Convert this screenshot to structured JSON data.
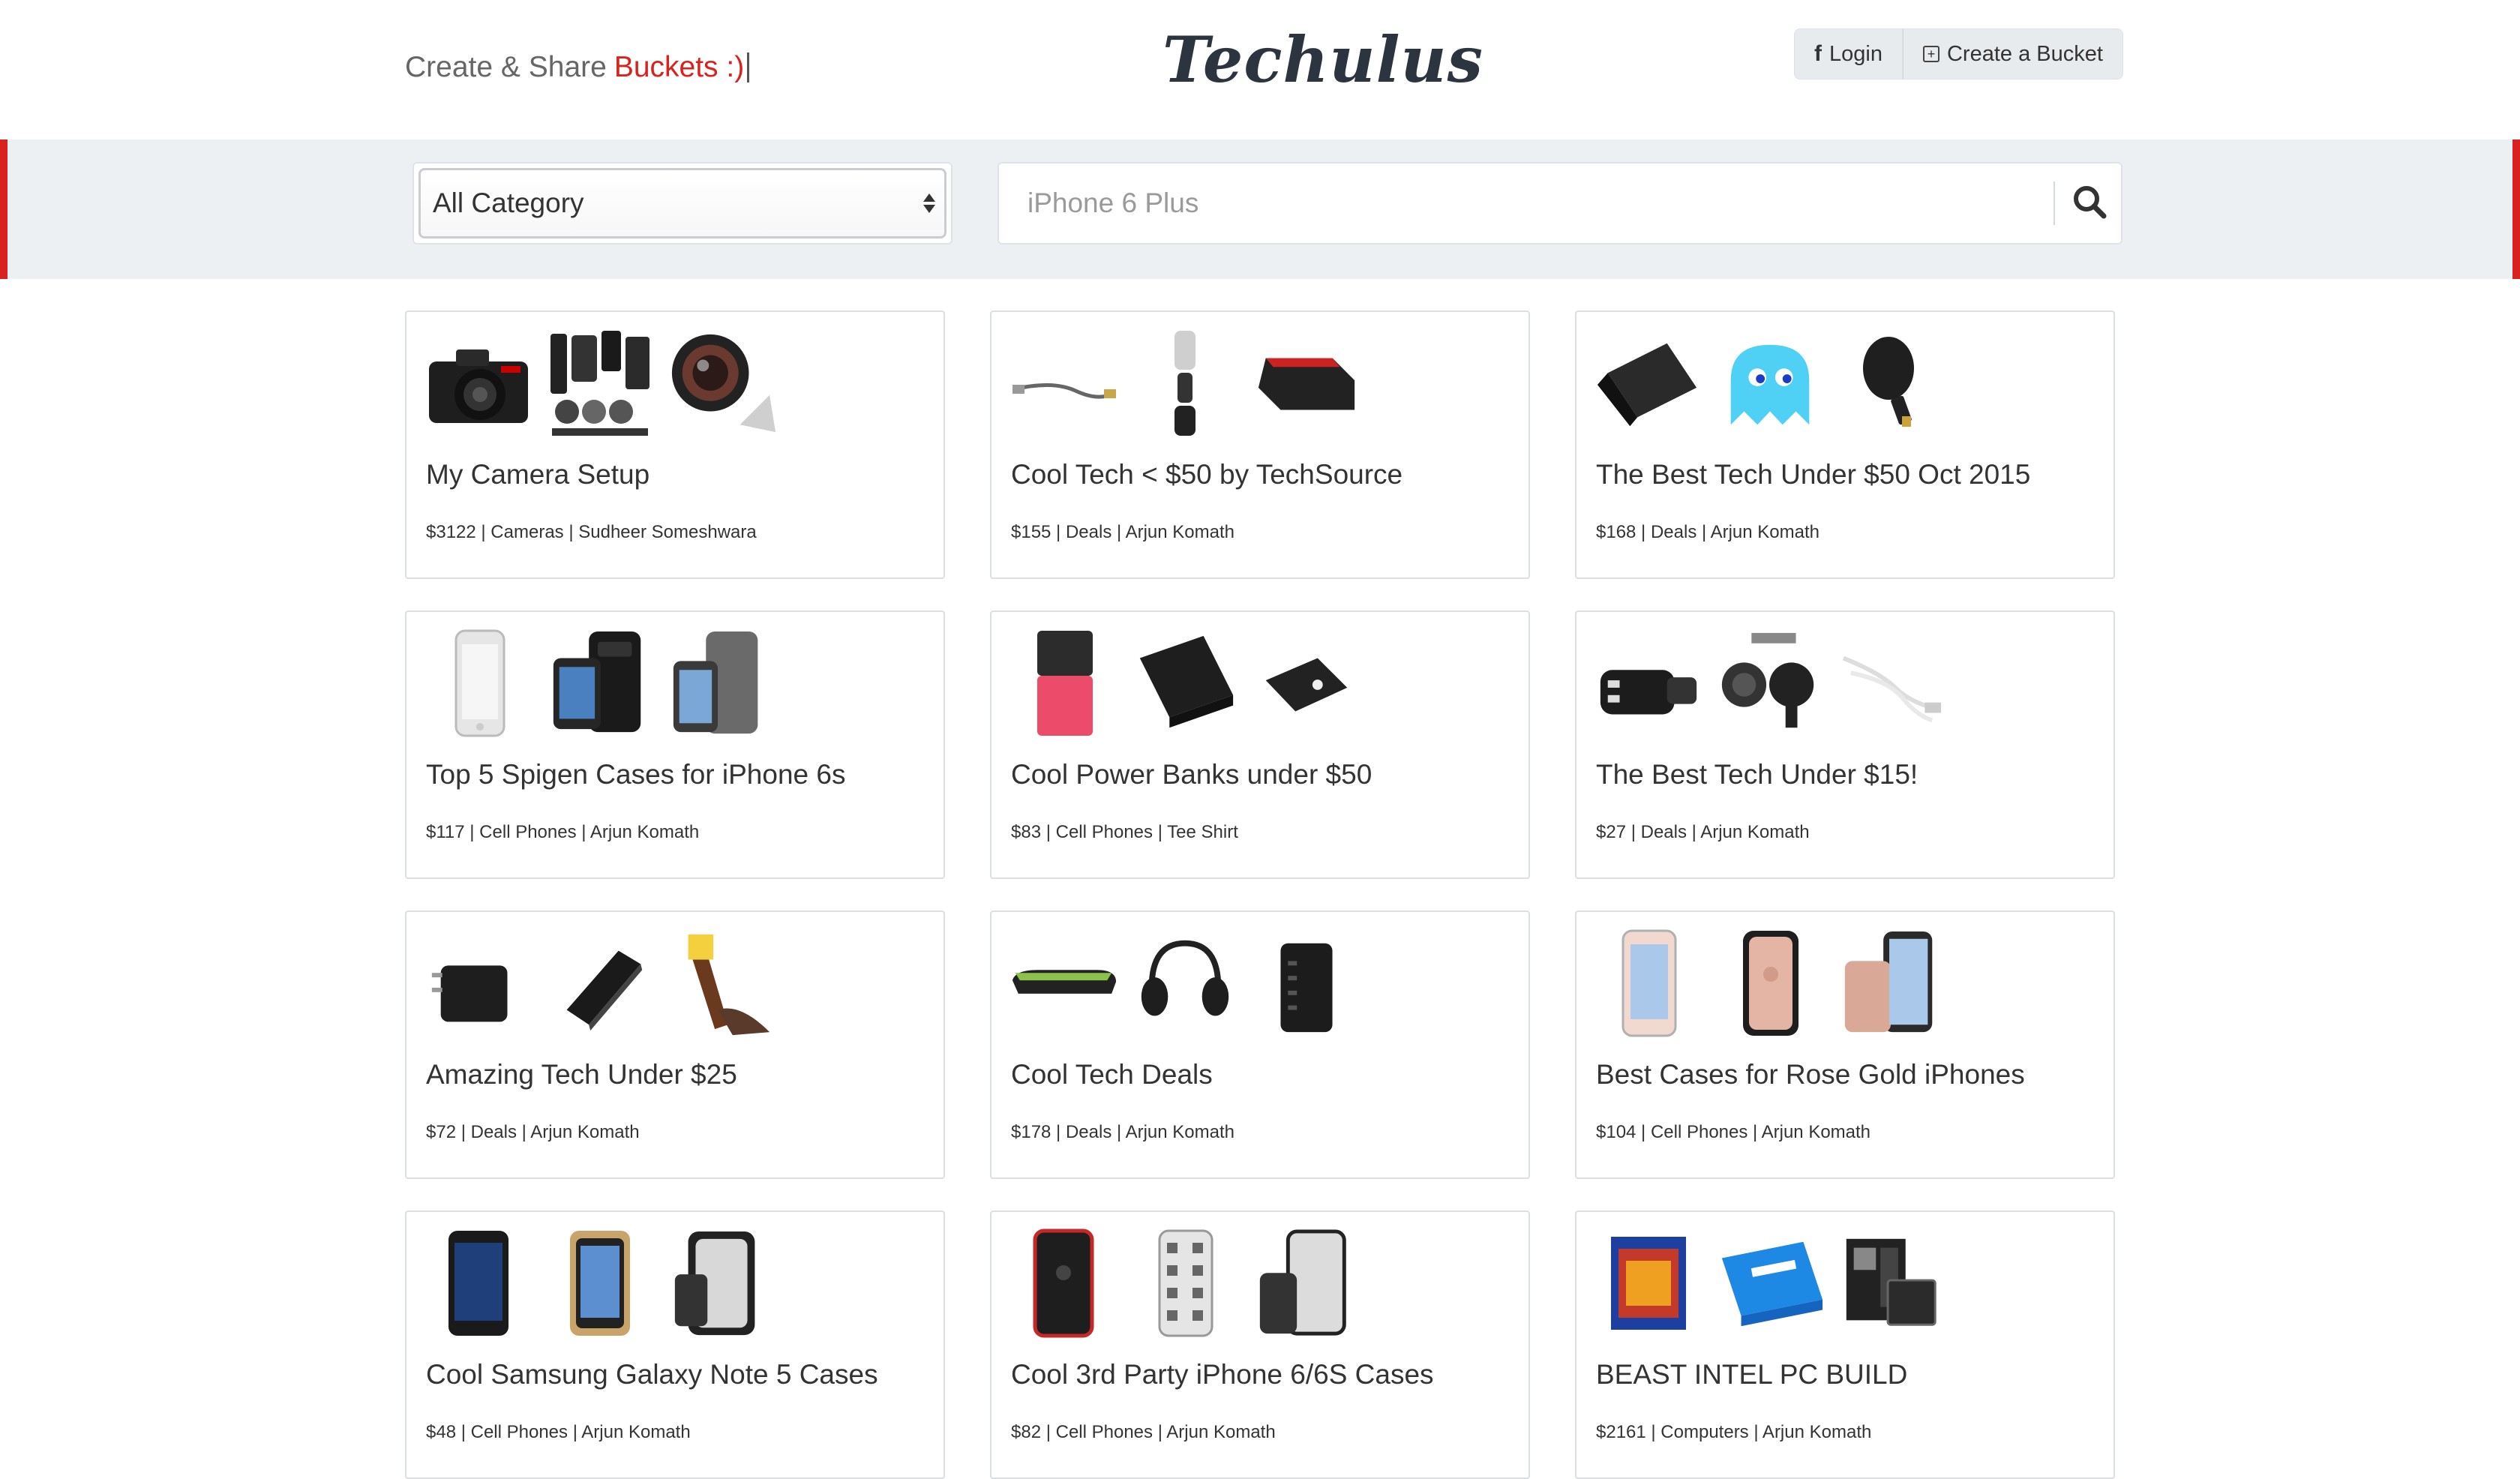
{
  "header": {
    "tagline_prefix": "Create & Share ",
    "tagline_accent": "Buckets :)",
    "logo": "Techulus",
    "login_label": "Login",
    "create_label": "Create a Bucket",
    "login_icon": "facebook-icon",
    "create_icon": "plus-square-icon"
  },
  "search": {
    "category_selected": "All Category",
    "placeholder": "iPhone 6 Plus",
    "button_icon": "search-icon"
  },
  "colors": {
    "accent": "#d9211d",
    "bar_background": "#edf0f3",
    "button_background": "#e8ebee"
  },
  "buckets": [
    {
      "title": "My Camera Setup",
      "meta": "$3122 | Cameras | Sudheer Someshwara"
    },
    {
      "title": "Cool Tech < $50 by TechSource",
      "meta": "$155 | Deals | Arjun Komath"
    },
    {
      "title": "The Best Tech Under $50 Oct 2015",
      "meta": "$168 | Deals | Arjun Komath"
    },
    {
      "title": "Top 5 Spigen Cases for iPhone 6s",
      "meta": "$117 | Cell Phones | Arjun Komath"
    },
    {
      "title": "Cool Power Banks under $50",
      "meta": "$83 | Cell Phones | Tee Shirt"
    },
    {
      "title": "The Best Tech Under $15!",
      "meta": "$27 | Deals | Arjun Komath"
    },
    {
      "title": "Amazing Tech Under $25",
      "meta": "$72 | Deals | Arjun Komath"
    },
    {
      "title": "Cool Tech Deals",
      "meta": "$178 | Deals | Arjun Komath"
    },
    {
      "title": "Best Cases for Rose Gold iPhones",
      "meta": "$104 | Cell Phones | Arjun Komath"
    },
    {
      "title": "Cool Samsung Galaxy Note 5 Cases",
      "meta": "$48 | Cell Phones | Arjun Komath"
    },
    {
      "title": "Cool 3rd Party iPhone 6/6S Cases",
      "meta": "$82 | Cell Phones | Arjun Komath"
    },
    {
      "title": "BEAST INTEL PC BUILD",
      "meta": "$2161 | Computers | Arjun Komath"
    }
  ]
}
